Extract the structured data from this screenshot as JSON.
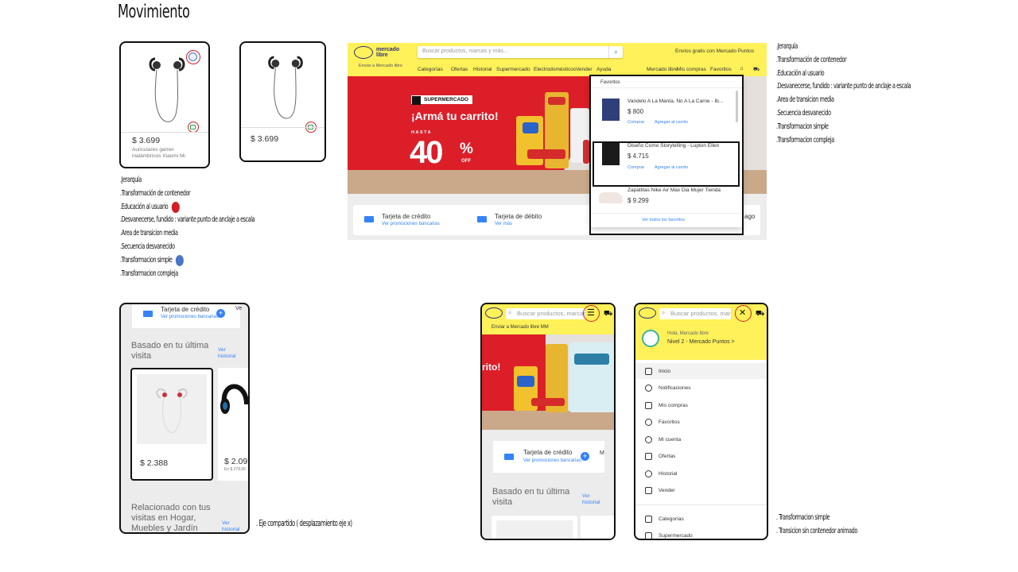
{
  "page": {
    "title": "Movimiento"
  },
  "colors": {
    "ml_yellow": "#fff159",
    "ml_blue": "#3483fa",
    "ml_navy": "#2d3277",
    "marker_red": "#d21f26",
    "marker_blue": "#4a76c4",
    "banner_red": "#dc1e28"
  },
  "cards": {
    "card1": {
      "price": "$ 3.699",
      "subtitle_line1": "Auriculares gamer",
      "subtitle_line2": "inalámbricos Xiaomi Mi"
    },
    "card2": {
      "price": "$ 3.699"
    }
  },
  "notes_left": [
    {
      "text": ".Jerarquía"
    },
    {
      "text": ".Transformación de contenedor"
    },
    {
      "text": ".Educación al usuario",
      "marker": "red"
    },
    {
      "text": ".Desvanecerse, fundido : variante punto de anclaje a escala"
    },
    {
      "text": ".Area de transicion media"
    },
    {
      "text": ".Secuencia desvanecido"
    },
    {
      "text": ".Transformacion simple",
      "marker": "blue"
    },
    {
      "text": ".Transformacion compleja"
    }
  ],
  "notes_right": [
    ".Jerarquía",
    ".Transformación de contenedor",
    ".Educación al usuario",
    ".Desvanecerse, fundido : variante punto de anclaje a escala",
    ".Area de transicion media",
    ".Secuencia desvanecido",
    ".Transformacion simple",
    ".Transformacion compleja"
  ],
  "desktop": {
    "brand_line1": "mercado",
    "brand_line2": "libre",
    "search_placeholder": "Buscar productos, marcas y más...",
    "shipping_promo": "Envíos gratis con Mercado Puntos",
    "address": "Enviar a Mercado libre",
    "nav": [
      "Categorías",
      "Ofertas",
      "Historial",
      "Supermercado",
      "Electrodomésticos",
      "Vender",
      "Ayuda"
    ],
    "nav_right": [
      "Mercado libre",
      "Mis compras",
      "Favoritos"
    ],
    "banner": {
      "badge": "SUPERMERCADO",
      "headline": "¡Armá tu carrito!",
      "hasta": "HASTA",
      "discount_number": "40",
      "discount_pct": "%",
      "discount_off": "OFF"
    },
    "payments": [
      {
        "title": "Tarjeta de crédito",
        "link": "Ver promociones bancarias"
      },
      {
        "title": "Tarjeta de débito",
        "link": "Ver más"
      },
      {
        "title": "",
        "link": ""
      }
    ],
    "payment_cut_text": "ago",
    "favorites": {
      "title": "Favoritos",
      "items": [
        {
          "name": "Vandelo A La Manta, No A La Carne - Ib...",
          "price": "$ 800",
          "buy": "Comprar",
          "add": "Agregar al carrito"
        },
        {
          "name": "Diseño Como Storytelling - Lupton Ellen",
          "price": "$ 4.715",
          "buy": "Comprar",
          "add": "Agregar al carrito"
        },
        {
          "name": "Zapatillas Nike Air Max Dia Mujer Tienda",
          "price": "$ 9.299",
          "buy": "",
          "add": ""
        }
      ],
      "see_all": "Ver todos los favoritos"
    }
  },
  "phone1": {
    "strip_title": "Tarjeta de crédito",
    "strip_link": "Ver promociones bancarias",
    "strip_cut": "Ve",
    "section_title_line1": "Basado en tu última",
    "section_title_line2": "visita",
    "see_history_line1": "Ver",
    "see_history_line2": "historial",
    "product1_price": "$ 2.388",
    "product2_price": "$ 2.09",
    "product2_old": "En $ 279,56",
    "related_line1": "Relacionado con tus",
    "related_line2": "visitas en Hogar,",
    "related_line3": "Muebles y Jardín",
    "related_link_line1": "Ver",
    "related_link_line2": "historial"
  },
  "caption_shared_axis": ". Eje compartido ( desplazamiento eje x)",
  "phone2": {
    "search_placeholder": "Buscar productos, marcas y más...",
    "address": "Enviar a Mercado libre MM",
    "banner_text": "rito!",
    "strip_title": "Tarjeta de crédito",
    "strip_link": "Ver promociones bancarias",
    "strip_cut": "M",
    "section_title_line1": "Basado en tu última",
    "section_title_line2": "visita",
    "see_history_line1": "Ver",
    "see_history_line2": "historial"
  },
  "phone3": {
    "search_placeholder": "Buscar productos, marcas y más...",
    "greeting": "Hola, Mercado libre",
    "level": "Nivel 2 - Mercado Puntos >",
    "menu": [
      "Inicio",
      "Notificaciones",
      "Mis compras",
      "Favoritos",
      "Mi cuenta",
      "Ofertas",
      "Historial",
      "Vender"
    ],
    "menu_bottom": [
      "Categorías",
      "Supermercado"
    ]
  },
  "notes_bottom_right": [
    ". Transformacion simple",
    ". Transicion sin contenedor animado"
  ]
}
